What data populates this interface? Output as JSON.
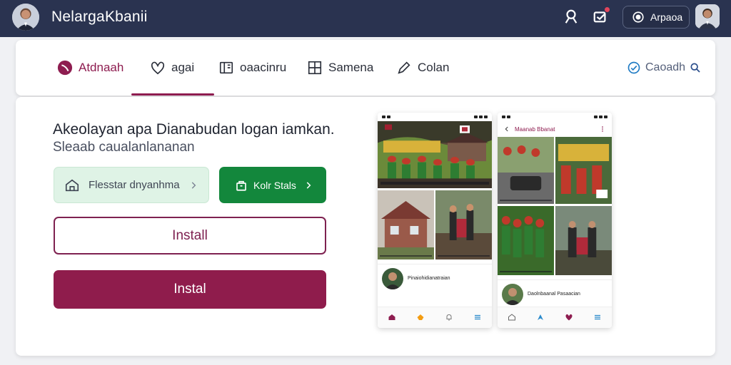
{
  "header": {
    "app_title": "NelargaKbanii",
    "account_label": "Arpaoa",
    "icons": [
      "user-avatar-icon",
      "profile-icon",
      "notification-icon",
      "account-icon",
      "user-avatar-icon"
    ]
  },
  "nav": {
    "tabs": [
      {
        "label": "Atdnaah",
        "icon": "brand-logo-icon",
        "active": true
      },
      {
        "label": "agai",
        "icon": "heart-icon",
        "active": false
      },
      {
        "label": "oaacinru",
        "icon": "book-icon",
        "active": false
      },
      {
        "label": "Samena",
        "icon": "grid-icon",
        "active": false
      },
      {
        "label": "Colan",
        "icon": "pen-icon",
        "active": false
      }
    ],
    "search_label": "Caoadh"
  },
  "main": {
    "headline": "Akeolayan apa Dianabudan logan iamkan.",
    "subline": "Sleaab caualanlananan",
    "btn_secondary_label": "Flesstar dnyanhma",
    "btn_primary_label": "Kolr Stals",
    "btn_outline_label": "Install",
    "btn_solid_label": "Instal"
  },
  "phones": [
    {
      "title": "",
      "hero_caption": "",
      "tile_captions": [
        "",
        ""
      ],
      "post_title": "Pinaiohidianatraian",
      "post_sub": "",
      "nav_items": [
        "",
        "",
        "",
        ""
      ]
    },
    {
      "title": "Maanab Bbanat",
      "hero_caption": "",
      "tile_captions": [
        "",
        ""
      ],
      "post_title": "Daolnbaanal Pasaacian",
      "post_sub": "",
      "nav_items": [
        "",
        "",
        "",
        ""
      ]
    }
  ],
  "colors": {
    "topbar": "#2a3350",
    "accent": "#8e1d50",
    "green": "#13873c",
    "light_green": "#dff3e6"
  }
}
